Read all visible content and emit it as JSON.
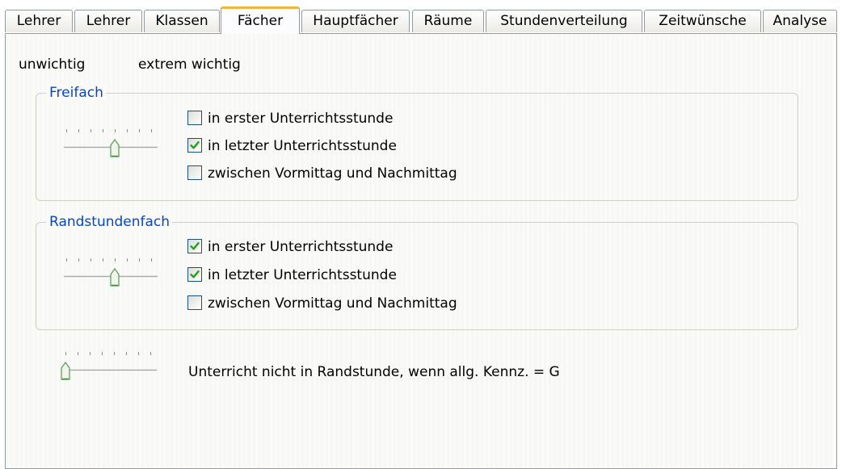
{
  "tabs": [
    {
      "label": "Lehrer",
      "active": false
    },
    {
      "label": "Lehrer",
      "active": false
    },
    {
      "label": "Klassen",
      "active": false
    },
    {
      "label": "Fächer",
      "active": true
    },
    {
      "label": "Hauptfächer",
      "active": false
    },
    {
      "label": "Räume",
      "active": false
    },
    {
      "label": "Stundenverteilung",
      "active": false
    },
    {
      "label": "Zeitwünsche",
      "active": false
    },
    {
      "label": "Analyse",
      "active": false
    }
  ],
  "scale": {
    "low_label": "unwichtig",
    "high_label": "extrem wichtig"
  },
  "groups": [
    {
      "title": "Freifach",
      "slider": {
        "value": 4,
        "max": 7
      },
      "options": [
        {
          "label": "in erster Unterrichtsstunde",
          "checked": false
        },
        {
          "label": "in letzter Unterrichtsstunde",
          "checked": true
        },
        {
          "label": "zwischen Vormittag und Nachmittag",
          "checked": false
        }
      ]
    },
    {
      "title": "Randstundenfach",
      "slider": {
        "value": 4,
        "max": 7
      },
      "options": [
        {
          "label": "in erster Unterrichtsstunde",
          "checked": true
        },
        {
          "label": "in letzter Unterrichtsstunde",
          "checked": true
        },
        {
          "label": "zwischen Vormittag und Nachmittag",
          "checked": false
        }
      ]
    }
  ],
  "standalone": {
    "label": "Unterricht nicht in Randstunde, wenn allg. Kennz. = G",
    "slider": {
      "value": 0,
      "max": 7
    }
  },
  "colors": {
    "accent": "#f4b33d",
    "group_title": "#0046d5",
    "check": "#21a121",
    "checkbox_border": "#1c5180"
  }
}
